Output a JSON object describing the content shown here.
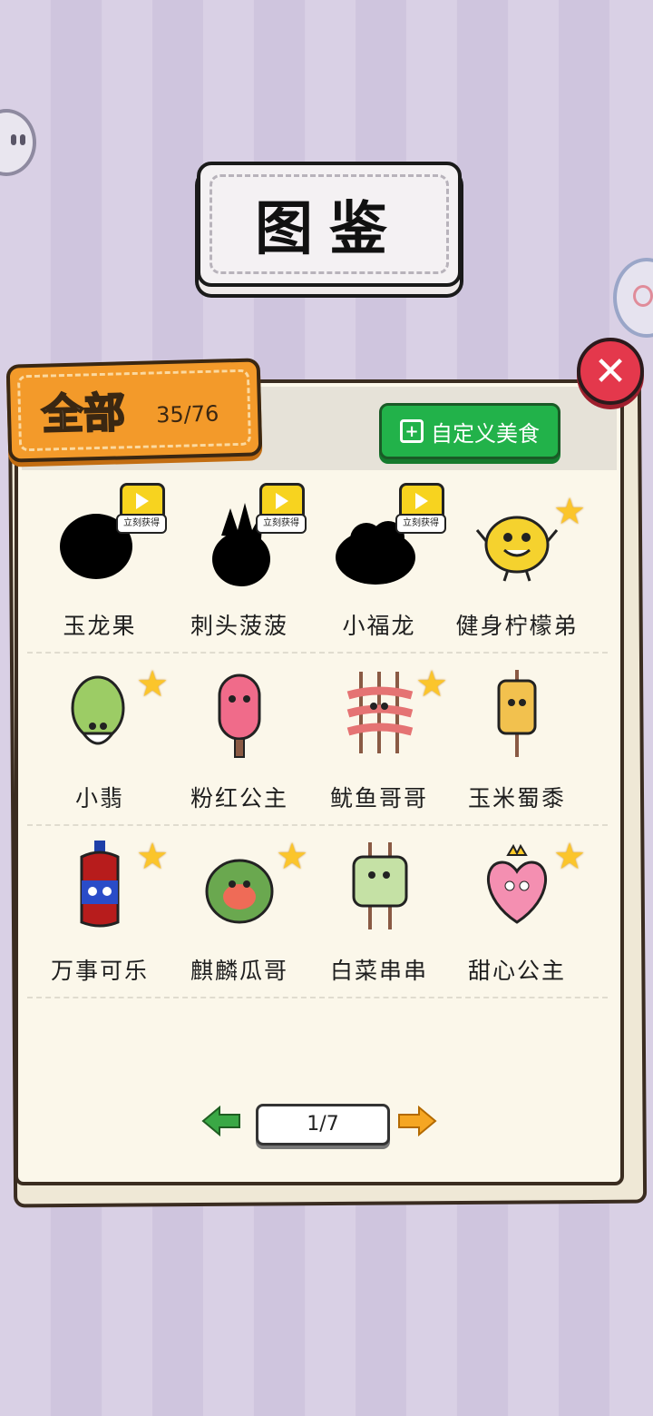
{
  "title": "图鉴",
  "tab": {
    "label": "全部",
    "count": "35/76"
  },
  "custom_button": "自定义美食",
  "close_label": "✕",
  "video_tag": "立刻获得",
  "rows": [
    [
      {
        "name": "玉龙果",
        "locked": true
      },
      {
        "name": "刺头菠菠",
        "locked": true
      },
      {
        "name": "小福龙",
        "locked": true
      },
      {
        "name": "健身柠檬弟",
        "starred": true
      }
    ],
    [
      {
        "name": "小翡",
        "starred": true
      },
      {
        "name": "粉红公主"
      },
      {
        "name": "鱿鱼哥哥",
        "starred": true
      },
      {
        "name": "玉米蜀黍"
      }
    ],
    [
      {
        "name": "万事可乐",
        "starred": true
      },
      {
        "name": "麒麟瓜哥",
        "starred": true
      },
      {
        "name": "白菜串串"
      },
      {
        "name": "甜心公主",
        "starred": true
      }
    ]
  ],
  "pager": {
    "label": "1/7"
  },
  "colors": {
    "accent_orange": "#f39a2a",
    "green": "#22b24a",
    "close_red": "#e4384c",
    "star": "#fbc52b"
  }
}
